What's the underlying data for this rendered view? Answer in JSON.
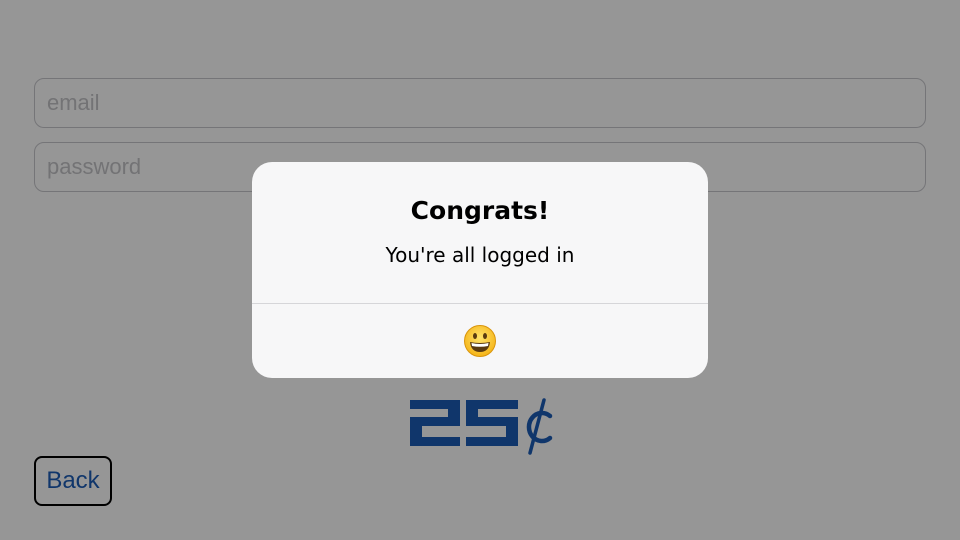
{
  "login_form": {
    "email_placeholder": "email",
    "password_placeholder": "password"
  },
  "logo": {
    "label": "25¢",
    "color": "#1c5cb6"
  },
  "back_button": {
    "label": "Back"
  },
  "alert": {
    "title": "Congrats!",
    "message": "You're all logged in",
    "action_icon": "grinning-face-emoji"
  },
  "colors": {
    "accent": "#1c5cb6",
    "overlay": "rgba(0,0,0,0.41)",
    "alert_background": "#f7f7f8"
  }
}
